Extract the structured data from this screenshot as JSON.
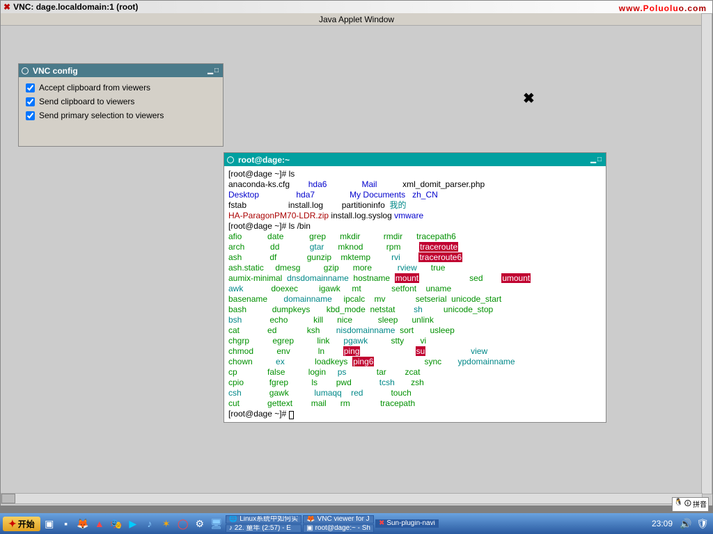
{
  "vnc": {
    "title": "VNC: dage.localdomain:1 (root)",
    "applet_bar": "Java Applet Window"
  },
  "watermark": {
    "a": "www.",
    "b": "Poluolu",
    "c": "o.com"
  },
  "config": {
    "title": "VNC config",
    "opts": [
      "Accept clipboard from viewers",
      "Send clipboard to viewers",
      "Send primary selection to viewers"
    ]
  },
  "term": {
    "title": "root@dage:~",
    "prompt1": "[root@dage ~]# ",
    "cmd1": "ls",
    "home": {
      "c1": [
        "anaconda-ks.cfg",
        "Desktop",
        "fstab",
        "HA-ParagonPM70-LDR.zip"
      ],
      "c2": [
        "hda6",
        "hda7",
        "install.log",
        "install.log.syslog"
      ],
      "c3": [
        "Mail",
        "My Documents",
        "partitioninfo",
        "vmware"
      ],
      "c4": [
        "xml_domit_parser.php",
        "zh_CN",
        "我的"
      ]
    },
    "cmd2_prompt": "[root@dage ~]# ",
    "cmd2": "ls /bin",
    "bin": {
      "c1": [
        "afio",
        "arch",
        "ash",
        "ash.static",
        "aumix-minimal",
        "awk",
        "basename",
        "bash",
        "bsh",
        "cat",
        "chgrp",
        "chmod",
        "chown",
        "cp",
        "cpio",
        "csh",
        "cut"
      ],
      "c2": [
        "date",
        "dd",
        "df",
        "dmesg",
        "dnsdomainname",
        "doexec",
        "domainname",
        "dumpkeys",
        "echo",
        "ed",
        "egrep",
        "env",
        "ex",
        "false",
        "fgrep",
        "gawk",
        "gettext"
      ],
      "c3": [
        "grep",
        "gtar",
        "gunzip",
        "gzip",
        "hostname",
        "igawk",
        "ipcalc",
        "kbd_mode",
        "kill",
        "ksh",
        "link",
        "ln",
        "loadkeys",
        "login",
        "ls",
        "lumaqq",
        "mail"
      ],
      "c4": [
        "mkdir",
        "mknod",
        "mktemp",
        "more",
        "mount",
        "mt",
        "mv",
        "netstat",
        "nice",
        "nisdomainname",
        "pgawk",
        "ping",
        "ping6",
        "ps",
        "pwd",
        "red",
        "rm"
      ],
      "c5": [
        "rmdir",
        "rpm",
        "rvi",
        "rview",
        "sed",
        "setfont",
        "setserial",
        "sh",
        "sleep",
        "sort",
        "stty",
        "su",
        "sync",
        "tar",
        "tcsh",
        "touch",
        "tracepath"
      ],
      "c6": [
        "tracepath6",
        "traceroute",
        "traceroute6",
        "true",
        "umount",
        "uname",
        "unicode_start",
        "unicode_stop",
        "unlink",
        "usleep",
        "vi",
        "view",
        "ypdomainname",
        "zcat",
        "zsh"
      ]
    },
    "prompt3": "[root@dage ~]# "
  },
  "taskbar": {
    "start": "开始",
    "items1": [
      {
        "icon": "🌐",
        "label": "Linux系统中如何实"
      },
      {
        "icon": "♪",
        "label": "22. 童年 (2:57) - E"
      }
    ],
    "items2": [
      {
        "icon": "🦊",
        "label": "VNC viewer for J"
      },
      {
        "icon": "▣",
        "label": "root@dage:~ - Sh"
      }
    ],
    "items3": [
      {
        "icon": "✖",
        "label": "Sun-plugin-navi"
      }
    ],
    "ime": "拼音",
    "clock": "23:09"
  }
}
